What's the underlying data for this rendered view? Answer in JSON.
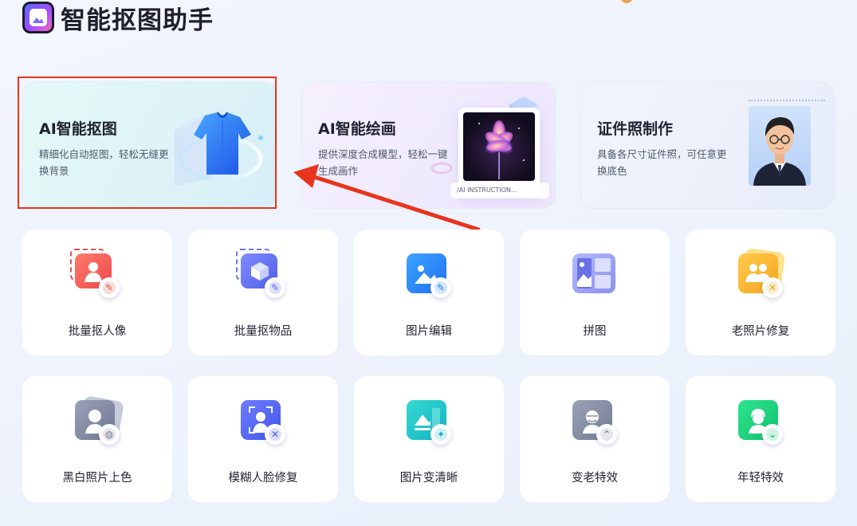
{
  "app": {
    "title": "智能抠图助手"
  },
  "features": [
    {
      "title": "AI智能抠图",
      "desc": "精细化自动抠图，轻松无缝更换背景"
    },
    {
      "title": "AI智能绘画",
      "desc": "提供深度合成模型，轻松一键生成画作",
      "instruction": "/AI INSTRUCTION..."
    },
    {
      "title": "证件照制作",
      "desc": "具备各尺寸证件照，可任意更换底色"
    }
  ],
  "tools": [
    {
      "label": "批量抠人像",
      "icon": "portrait-cutout-icon"
    },
    {
      "label": "批量抠物品",
      "icon": "object-cutout-icon"
    },
    {
      "label": "图片编辑",
      "icon": "image-edit-icon"
    },
    {
      "label": "拼图",
      "icon": "collage-icon"
    },
    {
      "label": "老照片修复",
      "icon": "old-photo-restore-icon"
    },
    {
      "label": "黑白照片上色",
      "icon": "colorize-icon"
    },
    {
      "label": "模糊人脸修复",
      "icon": "face-restore-icon"
    },
    {
      "label": "图片变清晰",
      "icon": "sharpen-icon"
    },
    {
      "label": "变老特效",
      "icon": "aging-effect-icon"
    },
    {
      "label": "年轻特效",
      "icon": "youth-effect-icon"
    }
  ],
  "colors": {
    "highlight": "#e8341c",
    "arrow": "#e8341c"
  }
}
